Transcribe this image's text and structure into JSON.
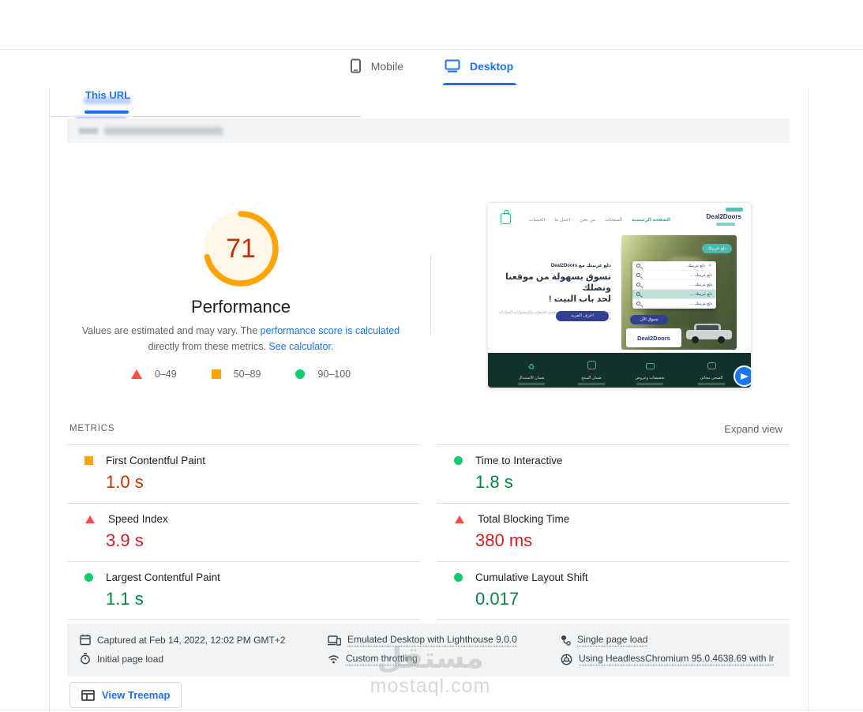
{
  "device_tabs": {
    "mobile": "Mobile",
    "desktop": "Desktop"
  },
  "url_tab": {
    "label": "This URL"
  },
  "score_section": {
    "score": "71",
    "title": "Performance",
    "desc_pre": "Values are estimated and may vary. The ",
    "link_calc": "performance score is calculated",
    "desc_mid": " directly from these metrics. ",
    "link_see": "See calculator.",
    "arc_color": "#ffa400",
    "score_color": "#c33300"
  },
  "legend": [
    {
      "label": "0–49",
      "rating": "fail"
    },
    {
      "label": "50–89",
      "rating": "average"
    },
    {
      "label": "90–100",
      "rating": "pass"
    }
  ],
  "metrics_bar": {
    "title": "METRICS",
    "expand": "Expand view"
  },
  "metrics": {
    "left": [
      {
        "name": "First Contentful Paint",
        "value": "1.0 s",
        "rating": "average"
      },
      {
        "name": "Speed Index",
        "value": "3.9 s",
        "rating": "fail"
      },
      {
        "name": "Largest Contentful Paint",
        "value": "1.1 s",
        "rating": "pass"
      }
    ],
    "right": [
      {
        "name": "Time to Interactive",
        "value": "1.8 s",
        "rating": "pass"
      },
      {
        "name": "Total Blocking Time",
        "value": "380 ms",
        "rating": "fail"
      },
      {
        "name": "Cumulative Layout Shift",
        "value": "0.017",
        "rating": "pass"
      }
    ]
  },
  "environment": {
    "captured": "Captured at Feb 14, 2022, 12:02 PM GMT+2",
    "initial_load": "Initial page load",
    "emulated": "Emulated Desktop with Lighthouse 9.0.0",
    "throttling": "Custom throttling",
    "single_page": "Single page load",
    "chromium": "Using HeadlessChromium 95.0.4638.69 with lr"
  },
  "treemap_button": {
    "label": "View Treemap"
  },
  "watermark": {
    "arabic": "مستقل",
    "latin": "mostaql.com"
  },
  "colors": {
    "accent_blue": "#1a73e8",
    "pass_text": "#018642",
    "average_text": "#c33300",
    "fail_text": "#cb2026",
    "pass_icon": "#0cce6b",
    "average_icon": "#ffa400",
    "fail_icon": "#ff4e42",
    "teal": "#2ab3a6",
    "navy": "#333f91",
    "thumb_footer_green": "#13302a"
  },
  "thumbnail": {
    "nav_links": [
      "الحساب",
      "اعمل بنا",
      "من نحن",
      "المنتجات",
      "الصفحة الرئيسية"
    ],
    "brand": "Deal2Doors",
    "hero_pill": "دلع عربيتك",
    "eyebrow": "دلع عربيتك مع Deal2Doors",
    "headline_1": "تسوق بسهولة من موقعنا ونصلك",
    "headline_2": "لحد باب البيت !",
    "paragraph": "تسوق من منزلك واختر وادلع عربيتك بافضل المنتجات واكسسوارات السيارات ونوصلك لحد باب البيت",
    "cta": "اعرف المزيد",
    "search_input": "دلع عربيتك",
    "search_results": [
      "دلع عربيتك …",
      "دلع عربيتك …",
      "دلع عربيتك …",
      "دلع عربيتك …"
    ],
    "shop_now": "تسوق الآن",
    "logo_text": "Deal2Doors",
    "footer_labels": [
      "ضمان الاستبدال",
      "ضمان المنتج",
      "تخفيضات وعروض",
      "الشحن مجاني"
    ]
  }
}
